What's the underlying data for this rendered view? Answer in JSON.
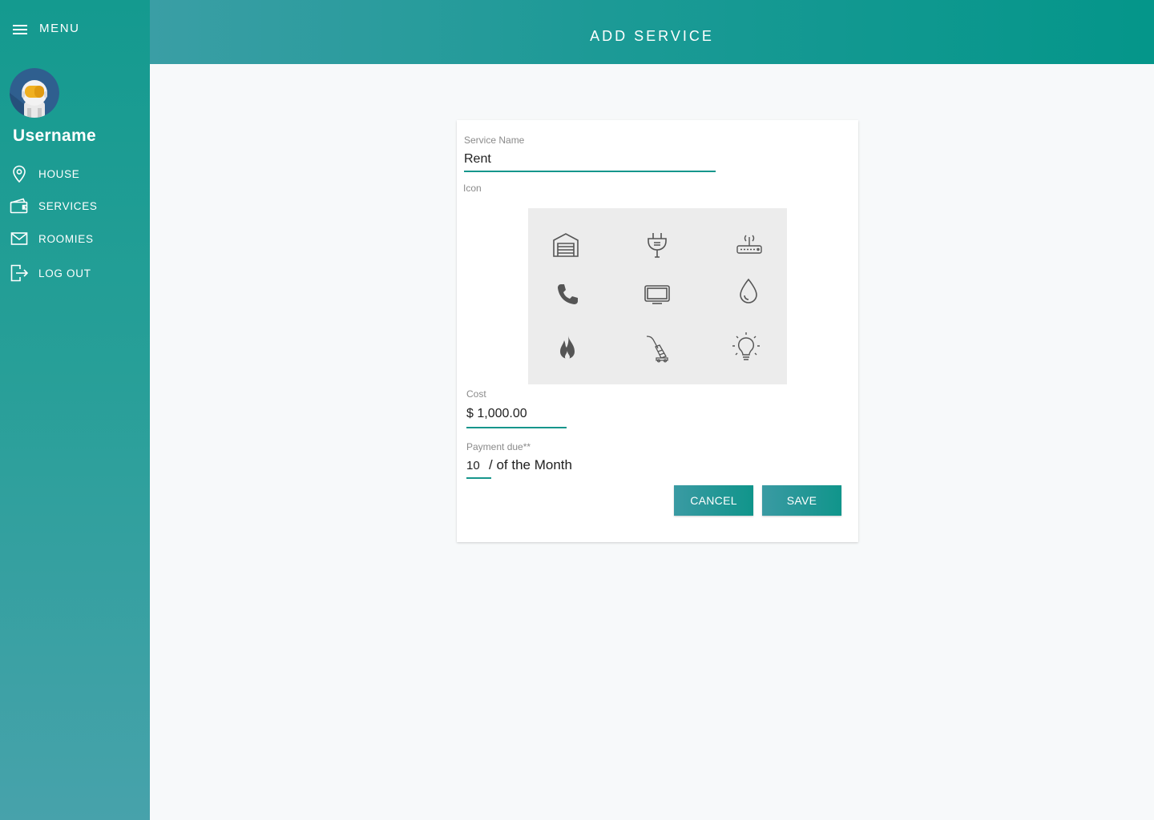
{
  "sidebar": {
    "menu_label": "MENU",
    "username": "Username",
    "items": [
      {
        "label": "HOUSE",
        "icon": "location-pin-icon"
      },
      {
        "label": "SERVICES",
        "icon": "wallet-icon"
      },
      {
        "label": "ROOMIES",
        "icon": "mail-icon"
      },
      {
        "label": "LOG OUT",
        "icon": "logout-icon"
      }
    ]
  },
  "header": {
    "title": "ADD SERVICE"
  },
  "form": {
    "service_name": {
      "label": "Service Name",
      "value": "Rent"
    },
    "icon": {
      "label": "Icon",
      "options": [
        "garage-icon",
        "plug-icon",
        "router-icon",
        "phone-icon",
        "tv-icon",
        "water-drop-icon",
        "flame-icon",
        "vacuum-icon",
        "lightbulb-icon"
      ]
    },
    "cost": {
      "label": "Cost",
      "value": "$ 1,000.00"
    },
    "payment_due": {
      "label": "Payment due**",
      "value": "10",
      "suffix": "/ of the Month"
    },
    "buttons": {
      "cancel": "CANCEL",
      "save": "SAVE"
    }
  },
  "colors": {
    "primary": "#16968c",
    "sidebar_top": "#149a8f",
    "sidebar_bottom": "#47a2ab"
  }
}
